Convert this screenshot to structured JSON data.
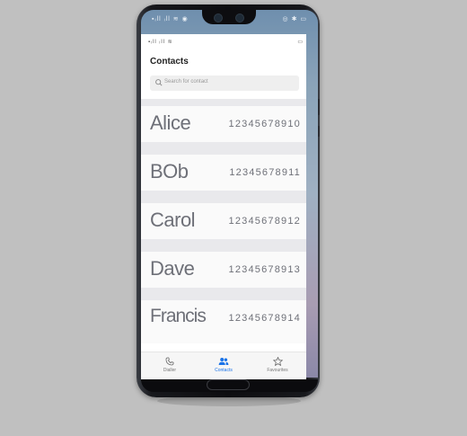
{
  "status_bar": {
    "left_icons": "▪ᵢll ᵢll ≋ ◉",
    "right_icons": "◎ ✱ ▭"
  },
  "app_status_bar": {
    "left_icons": "▪ᵢll ᵢll ≋",
    "right_icons": "▭"
  },
  "header": {
    "title": "Contacts"
  },
  "search": {
    "placeholder": "Search for contact"
  },
  "contacts": [
    {
      "name": "Alice",
      "number": "12345678910"
    },
    {
      "name": "BOb",
      "number": "12345678911"
    },
    {
      "name": "Carol",
      "number": "12345678912"
    },
    {
      "name": "Dave",
      "number": "12345678913"
    },
    {
      "name": "Francis",
      "number": "12345678914"
    }
  ],
  "bottom_nav": [
    {
      "label": "Dialler",
      "icon": "phone-icon",
      "active": false
    },
    {
      "label": "Contacts",
      "icon": "people-icon",
      "active": true
    },
    {
      "label": "Favourites",
      "icon": "star-icon",
      "active": false
    }
  ],
  "colors": {
    "accent": "#1a73e8",
    "handwriting": "#6e7078"
  }
}
